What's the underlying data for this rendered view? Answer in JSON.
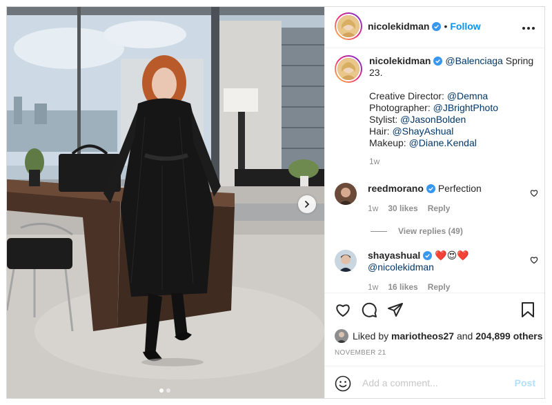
{
  "post": {
    "author": "nicolekidman",
    "follow_label": "Follow",
    "separator": "•",
    "more_label": "•••",
    "caption": {
      "author": "nicolekidman",
      "mention_brand": "@Balenciaga",
      "first_line_rest": " Spring 23.",
      "credits": [
        {
          "label": "Creative Director: ",
          "handle": "@Demna"
        },
        {
          "label": "Photographer: ",
          "handle": "@JBrightPhoto"
        },
        {
          "label": "Stylist: ",
          "handle": "@JasonBolden"
        },
        {
          "label": "Hair: ",
          "handle": "@ShayAshual"
        },
        {
          "label": "Makeup: ",
          "handle": "@Diane.Kendal"
        }
      ],
      "time": "1w"
    },
    "comments": [
      {
        "user": "reedmorano",
        "text": "Perfection",
        "time": "1w",
        "likes": "30 likes",
        "reply": "Reply"
      },
      {
        "user": "shayashual",
        "text_emoji": "❤️😍❤️",
        "mention": "@nicolekidman",
        "time": "1w",
        "likes": "16 likes",
        "reply": "Reply"
      }
    ],
    "view_replies": "View replies (49)",
    "liked_by": {
      "prefix": "Liked by ",
      "user": "mariotheos27",
      "middle": " and ",
      "count": "204,899 others"
    },
    "date": "NOVEMBER 21",
    "add_comment_placeholder": "Add a comment...",
    "post_button": "Post",
    "carousel": {
      "slide_count": 2,
      "active_index": 0
    }
  },
  "colors": {
    "accent": "#0095f6",
    "mention": "#00376b",
    "muted": "#8e8e8e",
    "post_disabled": "#b2dffc",
    "verified": "#3897f0"
  },
  "icons": [
    "more-icon",
    "verified-icon",
    "heart-icon",
    "comment-icon",
    "share-icon",
    "bookmark-icon",
    "emoji-icon",
    "chevron-right-icon"
  ]
}
